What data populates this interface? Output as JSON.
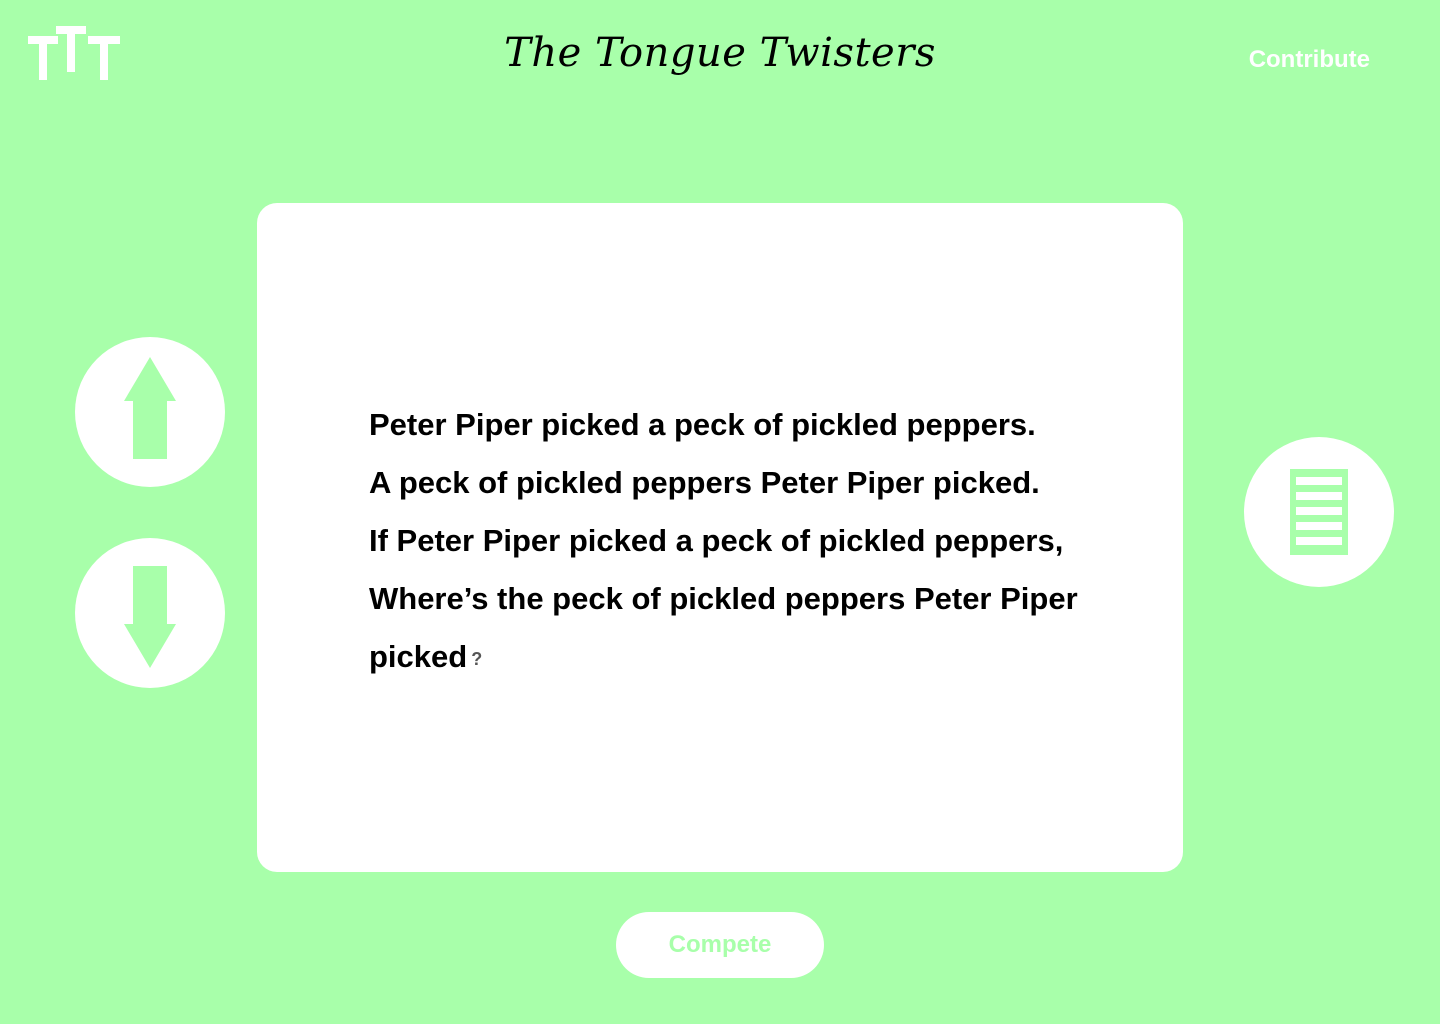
{
  "header": {
    "logo_icon": "ttt-logo-icon",
    "title": "The Tongue Twisters",
    "contribute_label": "Contribute"
  },
  "twister": {
    "lines": [
      "Peter Piper picked a peck of pickled peppers.",
      "A peck of pickled peppers Peter Piper picked.",
      "If Peter Piper picked a peck of pickled peppers,",
      "Where’s the peck of pickled peppers Peter Piper",
      "picked"
    ],
    "end_mark": "?"
  },
  "nav": {
    "up_icon": "arrow-up-icon",
    "down_icon": "arrow-down-icon",
    "list_icon": "list-icon"
  },
  "footer": {
    "compete_label": "Compete"
  },
  "colors": {
    "background": "#a8ffaa",
    "card": "#ffffff",
    "text": "#000000"
  }
}
